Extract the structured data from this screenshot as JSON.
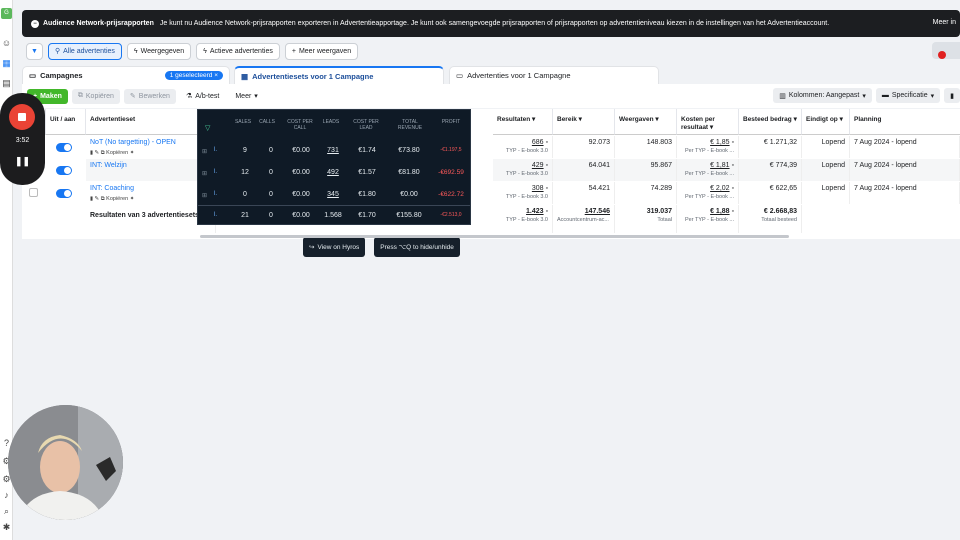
{
  "notice": {
    "title": "Audience Network-prijsrapporten",
    "text": "Je kunt nu Audience Network-prijsrapporten exporteren in Advertentieapportage. Je kunt ook samengevoegde prijsrapporten of prijsrapporten op advertentieniveau kiezen in de instellingen van het Advertentieaccount.",
    "more": "Meer in"
  },
  "filters": [
    "Alle advertenties",
    "Weergegeven",
    "Actieve advertenties",
    "Meer weergaven"
  ],
  "tabs": {
    "campaigns": "Campagnes",
    "selected": "1 geselecteerd",
    "adsets": "Advertentiesets voor 1 Campagne",
    "ads": "Advertenties voor 1 Campagne"
  },
  "toolbar": {
    "create": "Maken",
    "copy": "Kopiëren",
    "edit": "Bewerken",
    "ab": "A/b-test",
    "more": "Meer",
    "columns": "Kolommen: Aangepast",
    "breakdown": "Specificatie"
  },
  "headers": {
    "onoff": "Uit / aan",
    "adset": "Advertentieset",
    "results": "Resultaten",
    "reach": "Bereik",
    "impressions": "Weergaven",
    "cpr": "Kosten per resultaat",
    "spent": "Besteed bedrag",
    "ends": "Eindigt op",
    "schedule": "Planning"
  },
  "row_actions": {
    "copy": "Kopiëren"
  },
  "rows": [
    {
      "name": "NoT (No targetting) - OPEN",
      "results": "686",
      "results_sub": "TYP - E-book 3.0",
      "reach": "92.073",
      "impressions": "148.803",
      "cpr": "€ 1,85",
      "cpr_sub": "Per TYP - E-book ...",
      "spent": "€ 1.271,32",
      "ends": "Lopend",
      "schedule": "7 Aug 2024 - lopend"
    },
    {
      "name": "INT: Welzijn",
      "results": "429",
      "results_sub": "TYP - E-book 3.0",
      "reach": "64.041",
      "impressions": "95.867",
      "cpr": "€ 1,81",
      "cpr_sub": "Per TYP - E-book ...",
      "spent": "€ 774,39",
      "ends": "Lopend",
      "schedule": "7 Aug 2024 - lopend"
    },
    {
      "name": "INT: Coaching",
      "results": "308",
      "results_sub": "TYP - E-book 3.0",
      "reach": "54.421",
      "impressions": "74.289",
      "cpr": "€ 2,02",
      "cpr_sub": "Per TYP - E-book ...",
      "spent": "€ 622,65",
      "ends": "Lopend",
      "schedule": "7 Aug 2024 - lopend"
    }
  ],
  "totals": {
    "label": "Resultaten van 3 advertentiesets",
    "results": "1.423",
    "results_sub": "TYP - E-book 3.0",
    "reach": "147.546",
    "reach_sub": "Accountcentrum-ac...",
    "impressions": "319.037",
    "impressions_sub": "Totaal",
    "cpr": "€ 1,88",
    "cpr_sub": "Per TYP - E-book ...",
    "spent": "€ 2.668,83",
    "spent_sub": "Totaal besteed"
  },
  "overlay": {
    "headers": [
      "SALES",
      "CALLS",
      "COST PER CALL",
      "LEADS",
      "COST PER LEAD",
      "TOTAL REVENUE",
      "PROFIT"
    ],
    "rows": [
      [
        "9",
        "0",
        "€0.00",
        "731",
        "€1.74",
        "€73.80",
        "-€1.197,5"
      ],
      [
        "12",
        "0",
        "€0.00",
        "492",
        "€1.57",
        "€81.80",
        "-€692.59"
      ],
      [
        "0",
        "0",
        "€0.00",
        "345",
        "€1.80",
        "€0.00",
        "-€622.72"
      ],
      [
        "21",
        "0",
        "€0.00",
        "1.568",
        "€1.70",
        "€155.80",
        "-€2.513,0"
      ]
    ],
    "btn_view": "View on Hyros",
    "btn_hide": "Press ⌥Q to hide/unhide"
  },
  "recorder": {
    "time": "3:52"
  }
}
